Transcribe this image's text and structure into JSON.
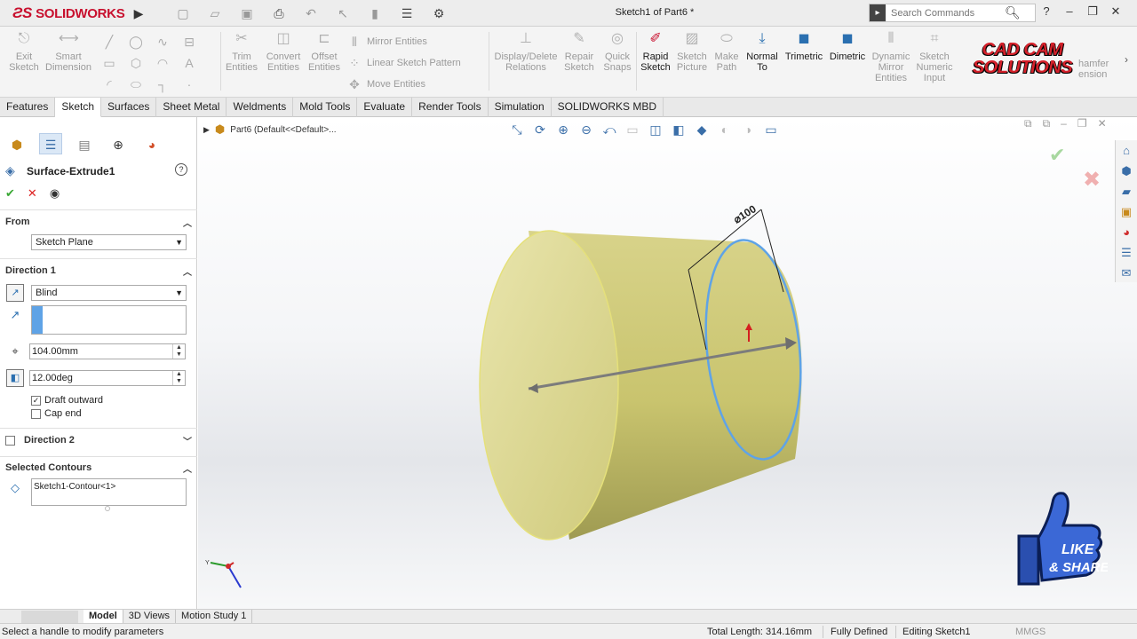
{
  "app": {
    "brand": "SOLIDWORKS",
    "doc_title": "Sketch1 of Part6 *",
    "search_placeholder": "Search Commands",
    "help": "?"
  },
  "command_manager": {
    "buttons": {
      "exit_sketch": "Exit Sketch",
      "smart_dimension": "Smart Dimension",
      "trim_entities": "Trim Entities",
      "convert_entities": "Convert Entities",
      "offset_entities": "Offset Entities",
      "mirror_entities": "Mirror Entities",
      "linear_sketch_pattern": "Linear Sketch Pattern",
      "move_entities": "Move Entities",
      "display_delete_relations": "Display/Delete Relations",
      "repair_sketch": "Repair Sketch",
      "quick_snaps": "Quick Snaps",
      "rapid_sketch": "Rapid Sketch",
      "sketch_picture": "Sketch Picture",
      "make_path": "Make Path",
      "normal_to": "Normal To",
      "trimetric": "Trimetric",
      "dimetric": "Dimetric",
      "dynamic_mirror_entities": "Dynamic Mirror Entities",
      "sketch_numeric_input": "Sketch Numeric Input",
      "chamfer_dimension_partial": "hamfer",
      "chamfer_dimension_partial_2": "ension"
    },
    "brand_overlay": [
      "CAD CAM",
      "SOLUTIONS"
    ]
  },
  "tabs": [
    "Features",
    "Sketch",
    "Surfaces",
    "Sheet Metal",
    "Weldments",
    "Mold Tools",
    "Evaluate",
    "Render Tools",
    "Simulation",
    "SOLIDWORKS MBD"
  ],
  "active_tab": "Sketch",
  "property_manager": {
    "title": "Surface-Extrude1",
    "from": {
      "header": "From",
      "value": "Sketch Plane"
    },
    "direction1": {
      "header": "Direction 1",
      "end_condition": "Blind",
      "depth": "104.00mm",
      "draft_angle": "12.00deg",
      "draft_outward_label": "Draft outward",
      "draft_outward_checked": true,
      "cap_end_label": "Cap end",
      "cap_end_checked": false
    },
    "direction2": {
      "header": "Direction 2",
      "checked": false
    },
    "selected_contours": {
      "header": "Selected Contours",
      "items": [
        "Sketch1-Contour<1>"
      ]
    }
  },
  "viewport": {
    "breadcrumb": "Part6  (Default<<Default>...",
    "dimension_label": "⌀100",
    "like_share": [
      "LIKE",
      "& SHARE"
    ]
  },
  "bottom_tabs": [
    "Model",
    "3D Views",
    "Motion Study 1"
  ],
  "active_bottom_tab": "Model",
  "statusbar": {
    "message": "Select a handle to modify parameters",
    "total_length": "Total Length: 314.16mm",
    "definition": "Fully Defined",
    "editing": "Editing Sketch1",
    "units": "MMGS"
  },
  "colors": {
    "accent": "#2a6fb0",
    "brand_red": "#c8102e",
    "part_surface": "#d9d48a",
    "sketch_edge": "#5fa3e6"
  }
}
